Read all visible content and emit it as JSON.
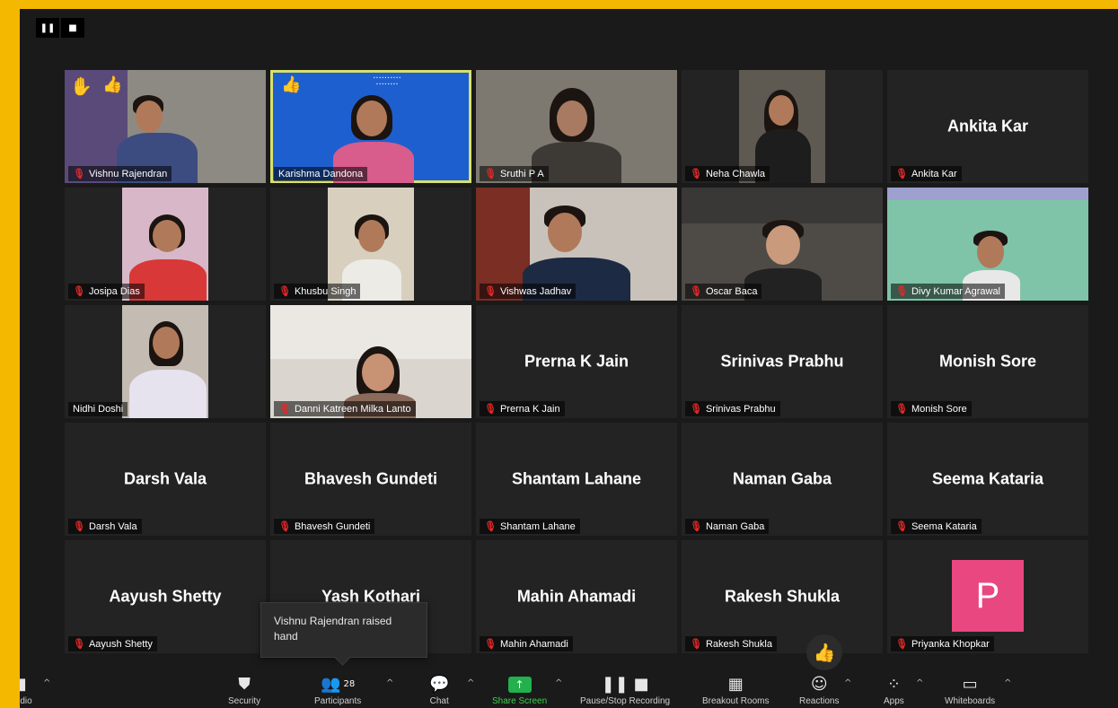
{
  "colors": {
    "frame": "#f5b800",
    "window_bg": "#1a1a1a",
    "tile_bg": "#232323",
    "active_border": "#d8e06c",
    "mic_off": "#e02828",
    "avatar_pink": "#e8477f",
    "share_green": "#22b14c"
  },
  "view_controls": [
    {
      "icon": "pause-icon",
      "glyph": "❚❚"
    },
    {
      "icon": "stop-icon",
      "glyph": "■"
    }
  ],
  "participants": [
    {
      "name": "Vishnu Rajendran",
      "label": "Vishnu Rajendran",
      "video": true,
      "hand_raised": true,
      "reaction": "thumbs-up"
    },
    {
      "name": "Karishma Dandona",
      "label": "Karishma Dandona",
      "video": true,
      "active_speaker": true,
      "reaction": "thumbs-up"
    },
    {
      "name": "Sruthi P A",
      "label": "Sruthi P A",
      "video": true
    },
    {
      "name": "Neha Chawla",
      "label": "Neha Chawla",
      "video": true
    },
    {
      "name": "Ankita Kar",
      "label": "Ankita Kar",
      "video": false
    },
    {
      "name": "Josipa Dias",
      "label": "Josipa Dias",
      "video": true
    },
    {
      "name": "Khusbu Singh",
      "label": "Khusbu Singh",
      "video": true
    },
    {
      "name": "Vishwas Jadhav",
      "label": "Vishwas Jadhav",
      "video": true
    },
    {
      "name": "Oscar Baca",
      "label": "Oscar Baca",
      "video": true
    },
    {
      "name": "Divy Kumar Agrawal",
      "label": "Divy Kumar Agrawal",
      "video": true
    },
    {
      "name": "Nidhi Doshi",
      "label": "Nidhi Doshi",
      "video": true
    },
    {
      "name": "Danni Katreen Milka Lanto",
      "label": "Danni Katreen Milka Lanto",
      "video": true
    },
    {
      "name": "Prerna K Jain",
      "label": "Prerna K Jain",
      "video": false
    },
    {
      "name": "Srinivas Prabhu",
      "label": "Srinivas Prabhu",
      "video": false
    },
    {
      "name": "Monish Sore",
      "label": "Monish Sore",
      "video": false
    },
    {
      "name": "Darsh Vala",
      "label": "Darsh Vala",
      "video": false
    },
    {
      "name": "Bhavesh Gundeti",
      "label": "Bhavesh Gundeti",
      "video": false
    },
    {
      "name": "Shantam Lahane",
      "label": "Shantam Lahane",
      "video": false
    },
    {
      "name": "Naman Gaba",
      "label": "Naman Gaba",
      "video": false
    },
    {
      "name": "Seema Kataria",
      "label": "Seema Kataria",
      "video": false
    },
    {
      "name": "Aayush Shetty",
      "label": "Aayush Shetty",
      "video": false
    },
    {
      "name": "Yash Kothari",
      "label": "",
      "video": false
    },
    {
      "name": "Mahin Ahamadi",
      "label": "Mahin Ahamadi",
      "video": false
    },
    {
      "name": "Rakesh Shukla",
      "label": "Rakesh Shukla",
      "video": false
    },
    {
      "name": "",
      "label": "Priyanka Khopkar",
      "video": false,
      "avatar_letter": "P"
    }
  ],
  "tooltip": {
    "text": "Vishnu Rajendran raised hand"
  },
  "toolbar": {
    "items": [
      {
        "name": "mute",
        "label": "...dio",
        "icon": "mic-icon",
        "glyph": "⬤"
      },
      {
        "name": "security",
        "label": "Security",
        "icon": "shield-icon",
        "glyph": "⛊"
      },
      {
        "name": "participants",
        "label": "Participants",
        "icon": "participants-icon",
        "glyph": "👥",
        "count": "28"
      },
      {
        "name": "chat",
        "label": "Chat",
        "icon": "chat-icon",
        "glyph": "💬"
      },
      {
        "name": "share-screen",
        "label": "Share Screen",
        "icon": "share-screen-icon",
        "glyph": "↑"
      },
      {
        "name": "pause-stop-recording",
        "label": "Pause/Stop Recording",
        "icon": "recording-icon",
        "glyph": "❚❚ ■"
      },
      {
        "name": "breakout-rooms",
        "label": "Breakout Rooms",
        "icon": "breakout-rooms-icon",
        "glyph": "▦"
      },
      {
        "name": "reactions",
        "label": "Reactions",
        "icon": "reactions-icon",
        "glyph": "☺"
      },
      {
        "name": "apps",
        "label": "Apps",
        "icon": "apps-icon",
        "glyph": "⁘"
      },
      {
        "name": "whiteboards",
        "label": "Whiteboards",
        "icon": "whiteboard-icon",
        "glyph": "▭"
      }
    ]
  }
}
